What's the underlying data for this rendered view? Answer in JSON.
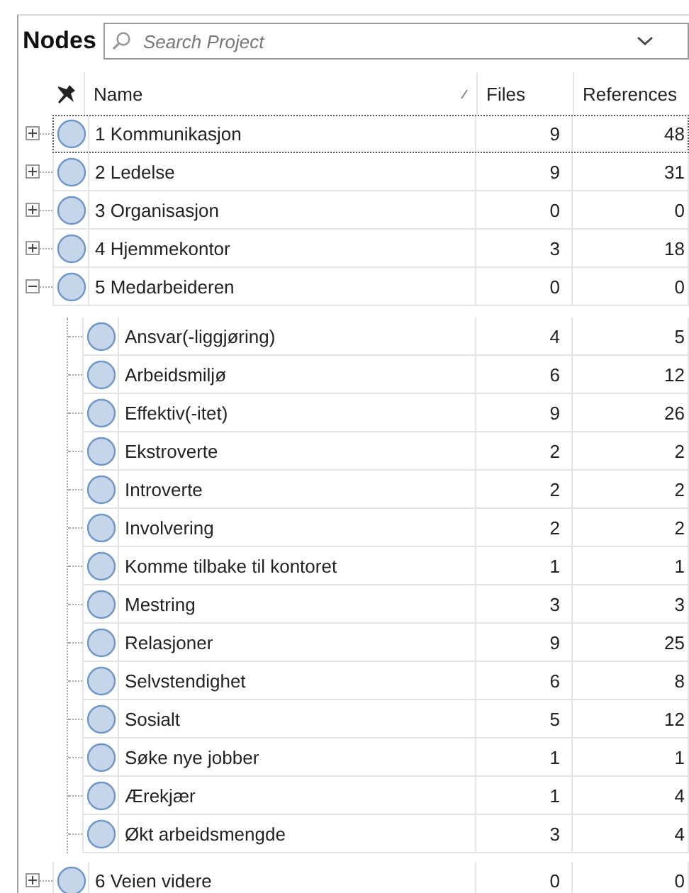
{
  "panel": {
    "title": "Nodes",
    "search": {
      "placeholder": "Search Project"
    }
  },
  "table": {
    "columns": [
      "Name",
      "Files",
      "References"
    ],
    "nodes": [
      {
        "name": "1 Kommunikasjon",
        "files": "9",
        "references": "48",
        "expanded": false,
        "focused": true
      },
      {
        "name": "2 Ledelse",
        "files": "9",
        "references": "31",
        "expanded": false,
        "focused": false
      },
      {
        "name": "3 Organisasjon",
        "files": "0",
        "references": "0",
        "expanded": false,
        "focused": false
      },
      {
        "name": "4 Hjemmekontor",
        "files": "3",
        "references": "18",
        "expanded": false,
        "focused": false
      },
      {
        "name": "5 Medarbeideren",
        "files": "0",
        "references": "0",
        "expanded": true,
        "focused": false,
        "children": [
          {
            "name": "Ansvar(-liggjøring)",
            "files": "4",
            "references": "5"
          },
          {
            "name": "Arbeidsmiljø",
            "files": "6",
            "references": "12"
          },
          {
            "name": "Effektiv(-itet)",
            "files": "9",
            "references": "26"
          },
          {
            "name": "Ekstroverte",
            "files": "2",
            "references": "2"
          },
          {
            "name": "Introverte",
            "files": "2",
            "references": "2"
          },
          {
            "name": "Involvering",
            "files": "2",
            "references": "2"
          },
          {
            "name": "Komme tilbake til kontoret",
            "files": "1",
            "references": "1"
          },
          {
            "name": "Mestring",
            "files": "3",
            "references": "3"
          },
          {
            "name": "Relasjoner",
            "files": "9",
            "references": "25"
          },
          {
            "name": "Selvstendighet",
            "files": "6",
            "references": "8"
          },
          {
            "name": "Sosialt",
            "files": "5",
            "references": "12"
          },
          {
            "name": "Søke nye jobber",
            "files": "1",
            "references": "1"
          },
          {
            "name": "Ærekjær",
            "files": "1",
            "references": "4"
          },
          {
            "name": "Økt arbeidsmengde",
            "files": "3",
            "references": "4"
          }
        ]
      },
      {
        "name": "6 Veien videre",
        "files": "0",
        "references": "0",
        "expanded": false,
        "focused": false
      }
    ]
  }
}
